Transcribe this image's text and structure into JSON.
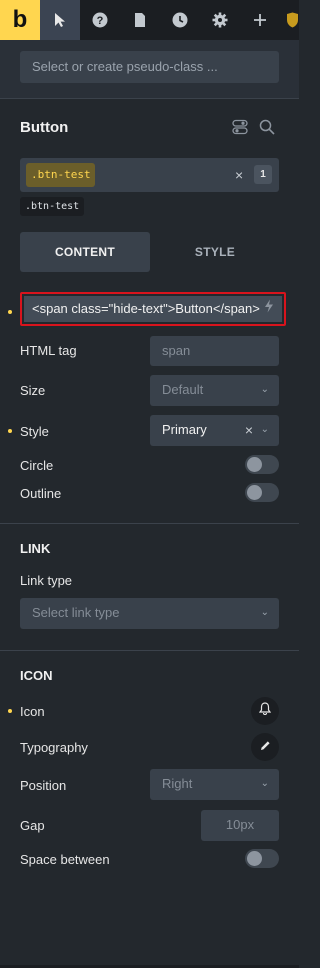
{
  "toolbar": {
    "logo_letter": "b",
    "icons": [
      "pointer-icon",
      "help-icon",
      "pages-icon",
      "history-icon",
      "settings-icon",
      "add-icon",
      "shield-icon"
    ]
  },
  "pseudo": {
    "placeholder": "Select or create pseudo-class ..."
  },
  "panel": {
    "title": "Button"
  },
  "classes": {
    "active_class": ".btn-test",
    "count": "1",
    "tag": ".btn-test"
  },
  "tabs": [
    {
      "label": "CONTENT"
    },
    {
      "label": "STYLE"
    }
  ],
  "content": {
    "text_value": "<span class=\"hide-text\">Button</span>",
    "html_tag": {
      "label": "HTML tag",
      "placeholder": "span"
    },
    "size": {
      "label": "Size",
      "placeholder": "Default"
    },
    "style": {
      "label": "Style",
      "value": "Primary"
    },
    "circle": {
      "label": "Circle",
      "on": false
    },
    "outline": {
      "label": "Outline",
      "on": false
    }
  },
  "link": {
    "title": "LINK",
    "link_type": {
      "label": "Link type",
      "placeholder": "Select link type"
    }
  },
  "icon": {
    "title": "ICON",
    "icon_label": "Icon",
    "typography_label": "Typography",
    "position": {
      "label": "Position",
      "placeholder": "Right"
    },
    "gap": {
      "label": "Gap",
      "placeholder": "10px"
    },
    "space_between": {
      "label": "Space between",
      "on": false
    }
  },
  "colors": {
    "accent": "#ffd64f",
    "highlight_border": "#d9141d",
    "panel_bg": "#23282d"
  }
}
